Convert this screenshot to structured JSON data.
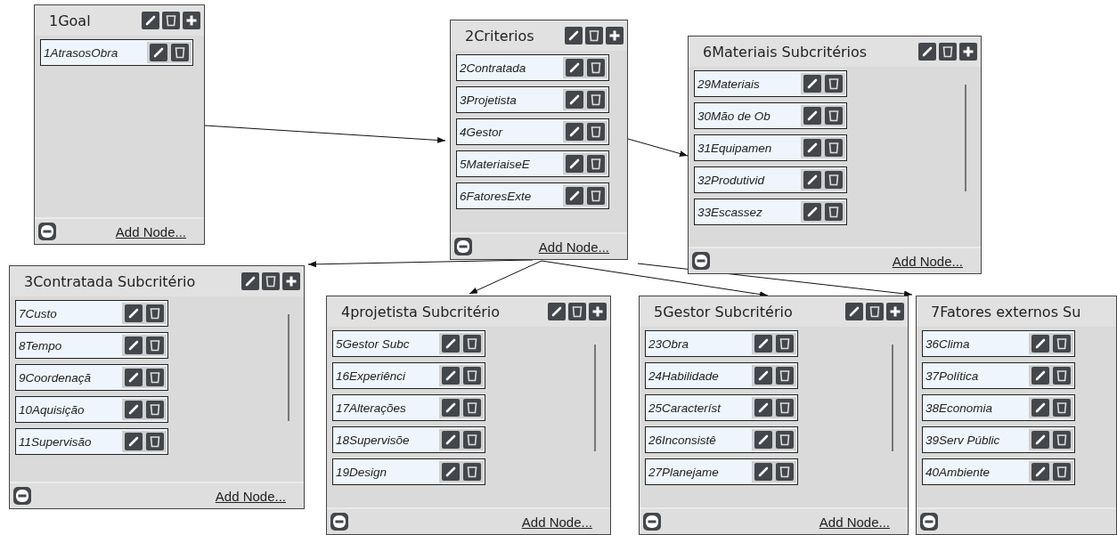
{
  "panels": [
    {
      "title": "1Goal",
      "tools": true,
      "scrollbar": false,
      "items": [
        "1AtrasosObra"
      ],
      "footer_link": "Add Node..."
    },
    {
      "title": "2Criterios",
      "tools": true,
      "scrollbar": false,
      "items": [
        "2Contratada",
        "3Projetista",
        "4Gestor",
        "5MateriaiseE",
        "6FatoresExte"
      ],
      "footer_link": "Add Node..."
    },
    {
      "title": "6Materiais Subcritérios",
      "tools": true,
      "scrollbar": true,
      "items": [
        "29Materiais",
        "30Mão de Ob",
        "31Equipamen",
        "32Produtivid",
        "33Escassez"
      ],
      "footer_link": "Add Node..."
    },
    {
      "title": "3Contratada Subcritério",
      "tools": true,
      "scrollbar": true,
      "items": [
        "7Custo",
        "8Tempo",
        "9Coordenaçã",
        "10Aquisição",
        "11Supervisão"
      ],
      "footer_link": "Add Node..."
    },
    {
      "title": "4projetista Subcritério",
      "tools": true,
      "scrollbar": true,
      "items": [
        "5Gestor Subc",
        "16Experiênci",
        "17Alterações",
        "18Supervisõe",
        "19Design"
      ],
      "footer_link": "Add Node..."
    },
    {
      "title": "5Gestor Subcritério",
      "tools": true,
      "scrollbar": true,
      "items": [
        "23Obra",
        "24Habilidade",
        "25Característ",
        "26Inconsistê",
        "27Planejame"
      ],
      "footer_link": "Add Node..."
    },
    {
      "title": "7Fatores externos Su",
      "tools": false,
      "scrollbar": false,
      "items": [
        "36Clima",
        "37Política",
        "38Economia",
        "39Serv Públic",
        "40Ambiente"
      ]
    }
  ]
}
